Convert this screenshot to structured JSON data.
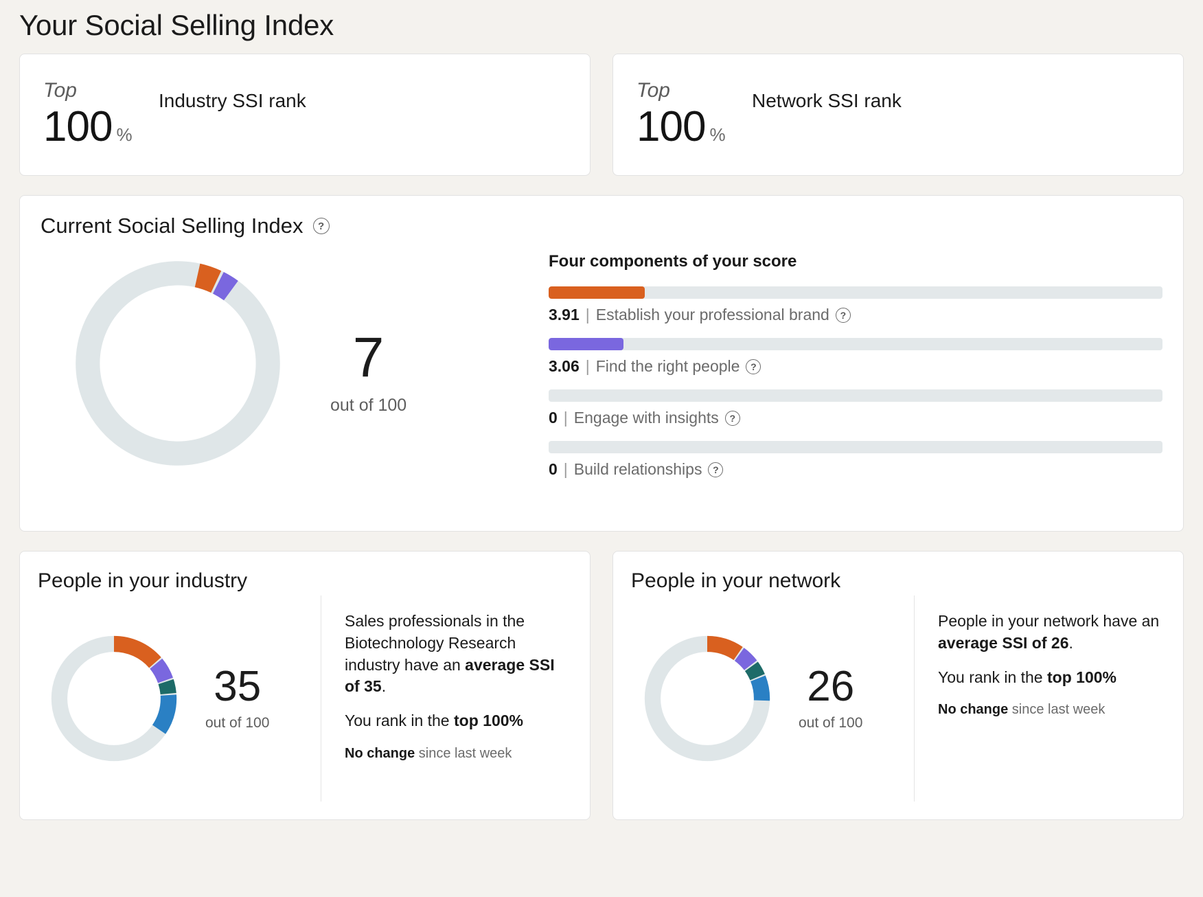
{
  "page": {
    "title": "Your Social Selling Index"
  },
  "colors": {
    "brand_orange": "#d9601f",
    "brand_purple": "#7a67df",
    "brand_teal": "#1d6b68",
    "brand_blue": "#2a80c4",
    "track_gray": "#dfe6e8",
    "bar_track": "#e3e8ea",
    "page_bg": "#f4f2ee"
  },
  "rank_cards": [
    {
      "top_word": "Top",
      "value": "100",
      "percent_symbol": "%",
      "label": "Industry SSI rank"
    },
    {
      "top_word": "Top",
      "value": "100",
      "percent_symbol": "%",
      "label": "Network SSI rank"
    }
  ],
  "current_ssi": {
    "heading": "Current Social Selling Index",
    "help_glyph": "?",
    "score": "7",
    "score_sub": "out of 100",
    "components_title": "Four components of your score",
    "components": [
      {
        "score": "3.91",
        "separator": "|",
        "label": "Establish your professional brand",
        "help_glyph": "?"
      },
      {
        "score": "3.06",
        "separator": "|",
        "label": "Find the right people",
        "help_glyph": "?"
      },
      {
        "score": "0",
        "separator": "|",
        "label": "Engage with insights",
        "help_glyph": "?"
      },
      {
        "score": "0",
        "separator": "|",
        "label": "Build relationships",
        "help_glyph": "?"
      }
    ]
  },
  "industry_card": {
    "title": "People in your industry",
    "score": "35",
    "score_sub": "out of 100",
    "text_line1_a": "Sales professionals in the Biotechnology Research industry have an ",
    "text_line1_b": "average SSI of 35",
    "text_line1_c": ".",
    "text_line2_a": "You rank in the ",
    "text_line2_b": "top 100%",
    "text_line3_a": "No change",
    "text_line3_b": " since last week"
  },
  "network_card": {
    "title": "People in your network",
    "score": "26",
    "score_sub": "out of 100",
    "text_line1_a": "People in your network have an ",
    "text_line1_b": "average SSI of 26",
    "text_line1_c": ".",
    "text_line2_a": "You rank in the ",
    "text_line2_b": "top 100%",
    "text_line3_a": "No change",
    "text_line3_b": " since last week"
  },
  "chart_data": [
    {
      "type": "pie",
      "title": "Current Social Selling Index",
      "total": 100,
      "value": 7,
      "labels": [
        "Establish your professional brand",
        "Find the right people",
        "Engage with insights",
        "Build relationships",
        "Remaining"
      ],
      "values": [
        3.91,
        3.06,
        0,
        0,
        93.03
      ],
      "colors": [
        "#d9601f",
        "#7a67df",
        "#1d6b68",
        "#2a80c4",
        "#dfe6e8"
      ],
      "legend": "none"
    },
    {
      "type": "bar",
      "title": "Four components of your score",
      "categories": [
        "Establish your professional brand",
        "Find the right people",
        "Engage with insights",
        "Build relationships"
      ],
      "values": [
        3.91,
        3.06,
        0,
        0
      ],
      "ylim": [
        0,
        25
      ],
      "colors": [
        "#d9601f",
        "#7a67df",
        "#1d6b68",
        "#2a80c4"
      ],
      "xlabel": "",
      "ylabel": "",
      "grid": false,
      "orientation": "horizontal"
    },
    {
      "type": "pie",
      "title": "People in your industry",
      "total": 100,
      "value": 35,
      "labels": [
        "Establish your professional brand",
        "Find the right people",
        "Engage with insights",
        "Build relationships",
        "Remaining"
      ],
      "values": [
        14,
        6,
        4,
        11,
        65
      ],
      "colors": [
        "#d9601f",
        "#7a67df",
        "#1d6b68",
        "#2a80c4",
        "#dfe6e8"
      ],
      "legend": "none"
    },
    {
      "type": "pie",
      "title": "People in your network",
      "total": 100,
      "value": 26,
      "labels": [
        "Establish your professional brand",
        "Find the right people",
        "Engage with insights",
        "Build relationships",
        "Remaining"
      ],
      "values": [
        10,
        5,
        4,
        7,
        74
      ],
      "colors": [
        "#d9601f",
        "#7a67df",
        "#1d6b68",
        "#2a80c4",
        "#dfe6e8"
      ],
      "legend": "none"
    }
  ]
}
